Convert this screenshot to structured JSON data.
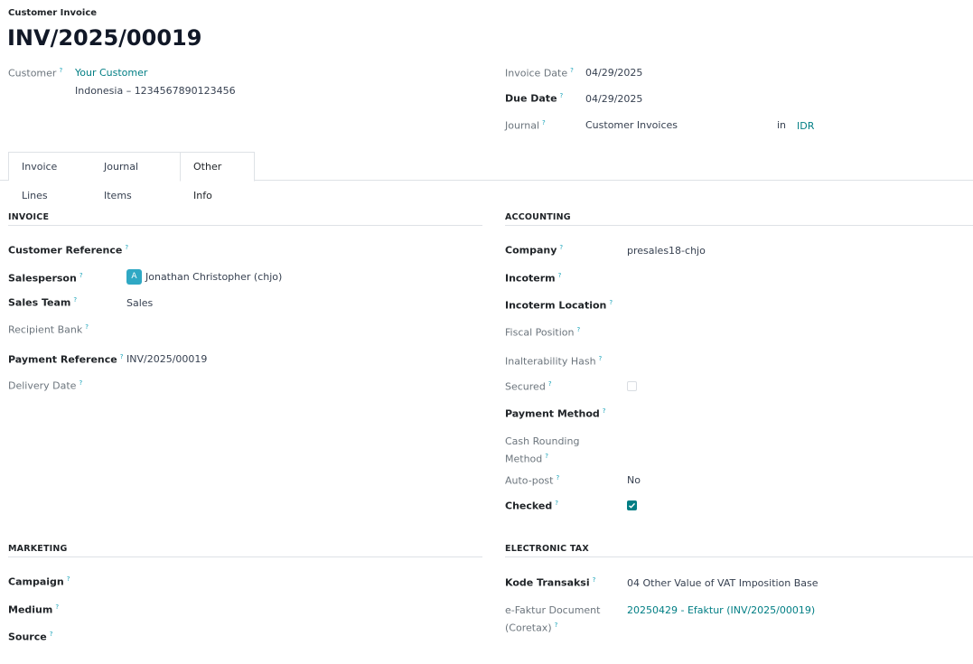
{
  "header": {
    "breadcrumb": "Customer Invoice",
    "title": "INV/2025/00019"
  },
  "customer": {
    "label": "Customer",
    "name": "Your Customer",
    "address": "Indonesia – 1234567890123456"
  },
  "dates": {
    "invoice_date_label": "Invoice Date",
    "invoice_date": "04/29/2025",
    "due_date_label": "Due Date",
    "due_date": "04/29/2025",
    "journal_label": "Journal",
    "journal": "Customer Invoices",
    "in_label": "in",
    "currency": "IDR"
  },
  "tabs": [
    {
      "label": "Invoice Lines"
    },
    {
      "label": "Journal Items"
    },
    {
      "label": "Other Info",
      "active": true
    }
  ],
  "invoice_section": {
    "title": "INVOICE",
    "customer_reference_label": "Customer Reference",
    "salesperson_label": "Salesperson",
    "salesperson_avatar": "A",
    "salesperson": "Jonathan Christopher (chjo)",
    "sales_team_label": "Sales Team",
    "sales_team": "Sales",
    "recipient_bank_label": "Recipient Bank",
    "payment_reference_label": "Payment Reference",
    "payment_reference": "INV/2025/00019",
    "delivery_date_label": "Delivery Date"
  },
  "accounting_section": {
    "title": "ACCOUNTING",
    "company_label": "Company",
    "company": "presales18-chjo",
    "incoterm_label": "Incoterm",
    "incoterm_location_label": "Incoterm Location",
    "fiscal_position_label": "Fiscal Position",
    "inalterability_hash_label": "Inalterability Hash",
    "secured_label": "Secured",
    "secured": false,
    "payment_method_label": "Payment Method",
    "cash_rounding_label_1": "Cash Rounding",
    "cash_rounding_label_2": "Method",
    "auto_post_label": "Auto-post",
    "auto_post": "No",
    "checked_label": "Checked",
    "checked": true
  },
  "marketing_section": {
    "title": "MARKETING",
    "campaign_label": "Campaign",
    "medium_label": "Medium",
    "source_label": "Source"
  },
  "electronic_tax_section": {
    "title": "ELECTRONIC TAX",
    "kode_transaksi_label": "Kode Transaksi",
    "kode_transaksi": "04 Other Value of VAT Imposition Base",
    "efaktur_label_1": "e-Faktur Document",
    "efaktur_label_2": "(Coretax)",
    "efaktur": "20250429 - Efaktur (INV/2025/00019)"
  },
  "help_marker": "?",
  "colors": {
    "link": "#017e84",
    "help": "#17a2b8",
    "avatar": "#2fa8c4"
  }
}
